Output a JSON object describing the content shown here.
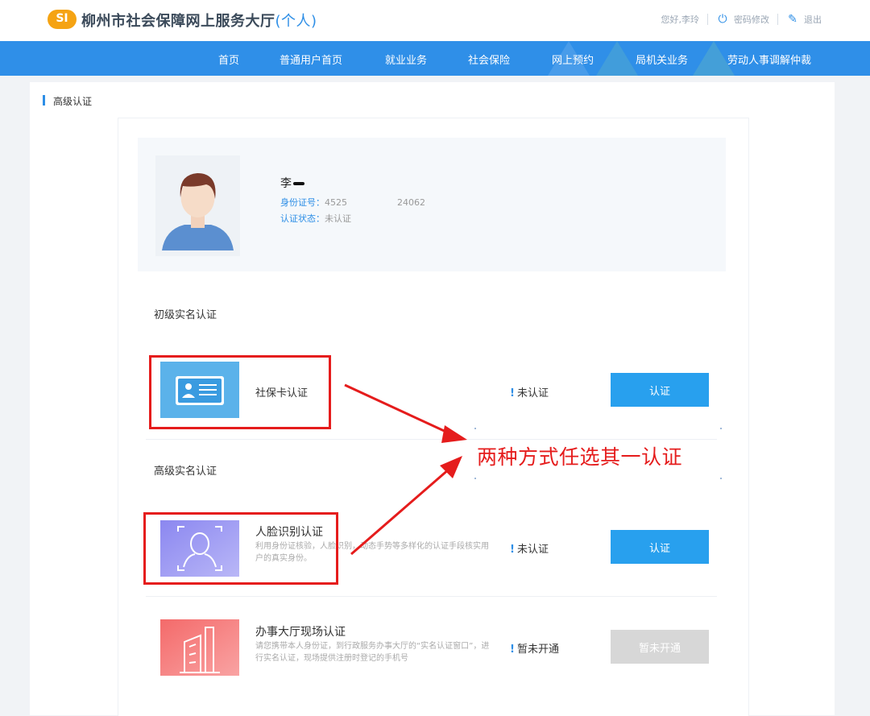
{
  "header": {
    "title": "柳州市社会保障网上服务大厅",
    "title_suffix": "(个人)",
    "greeting": "您好,李玲",
    "change_password": "密码修改",
    "logout": "退出"
  },
  "nav": {
    "items": [
      "首页",
      "普通用户首页",
      "就业业务",
      "社会保险",
      "网上预约",
      "局机关业务",
      "劳动人事调解仲裁"
    ]
  },
  "section_title": "高级认证",
  "profile": {
    "name": "李",
    "id_label": "身份证号：",
    "id_value": "4525",
    "id_tail": "24062",
    "status_label": "认证状态：",
    "status_value": "未认证"
  },
  "groups": {
    "basic": "初级实名认证",
    "advanced": "高级实名认证"
  },
  "items": [
    {
      "title": "社保卡认证",
      "desc": "",
      "status": "未认证",
      "button": "认证"
    },
    {
      "title": "人脸识别认证",
      "desc": "利用身份证核验，人脸识别，动态手势等多样化的认证手段核实用户的真实身份。",
      "status": "未认证",
      "button": "认证"
    },
    {
      "title": "办事大厅现场认证",
      "desc": "请您携带本人身份证，到行政服务办事大厅的“实名认证窗口”，进行实名认证，现场提供注册时登记的手机号",
      "status": "暂未开通",
      "button": "暂未开通"
    }
  ],
  "annotation": "两种方式任选其一认证",
  "colors": {
    "nav": "#2f8fe8",
    "accent": "#2d8ee6",
    "button": "#28a0ee",
    "annotation": "#e51c1c"
  }
}
